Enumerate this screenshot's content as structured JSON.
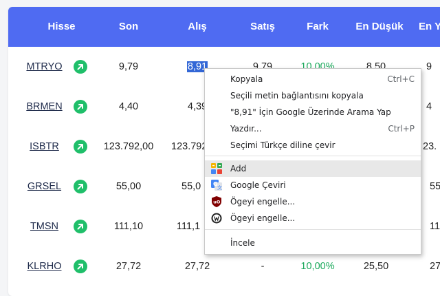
{
  "table": {
    "headers": [
      "Hisse",
      "Son",
      "Alış",
      "Satış",
      "Fark",
      "En Düşük",
      "En Y"
    ],
    "rows": [
      {
        "symbol": "MTRYO",
        "son": "9,79",
        "alis": "8,91",
        "satis": "9,79",
        "fark": "10,00%",
        "en_dusuk": "8,50",
        "en_y": "9"
      },
      {
        "symbol": "BRMEN",
        "son": "4,40",
        "alis": "4,39",
        "satis": "",
        "fark": "",
        "en_dusuk": "",
        "en_y": "4"
      },
      {
        "symbol": "ISBTR",
        "son": "123.792,00",
        "alis": "123.792",
        "satis": "",
        "fark": "",
        "en_dusuk": "",
        "en_y": "23."
      },
      {
        "symbol": "GRSEL",
        "son": "55,00",
        "alis": "55,0",
        "satis": "",
        "fark": "",
        "en_dusuk": "",
        "en_y": "55"
      },
      {
        "symbol": "TMSN",
        "son": "111,10",
        "alis": "111,1",
        "satis": "",
        "fark": "",
        "en_dusuk": "",
        "en_y": "11"
      },
      {
        "symbol": "KLRHO",
        "son": "27,72",
        "alis": "27,72",
        "satis": "-",
        "fark": "10,00%",
        "en_dusuk": "25,50",
        "en_y": "27"
      }
    ]
  },
  "context_menu": {
    "items": [
      {
        "label": "Kopyala",
        "shortcut": "Ctrl+C"
      },
      {
        "label": "Seçili metin bağlantısını kopyala",
        "shortcut": ""
      },
      {
        "label": "\"8,91\" İçin Google Üzerinde Arama Yap",
        "shortcut": ""
      },
      {
        "label": "Yazdır...",
        "shortcut": "Ctrl+P"
      },
      {
        "label": "Seçimi Türkçe diline çevir",
        "shortcut": ""
      },
      {
        "label": "Add",
        "shortcut": "",
        "icon": "add-extension-icon"
      },
      {
        "label": "Google Çeviri",
        "shortcut": "",
        "icon": "google-translate-icon"
      },
      {
        "label": "Ögeyi engelle...",
        "shortcut": "",
        "icon": "ublock-icon"
      },
      {
        "label": "Ögeyi engelle...",
        "shortcut": "",
        "icon": "adblock-icon"
      },
      {
        "label": "İncele",
        "shortcut": ""
      }
    ]
  },
  "colors": {
    "header_bg": "#4f6bf2",
    "up_green": "#1fbf6a",
    "positive_text": "#19a85a",
    "selection": "#3367d6"
  }
}
